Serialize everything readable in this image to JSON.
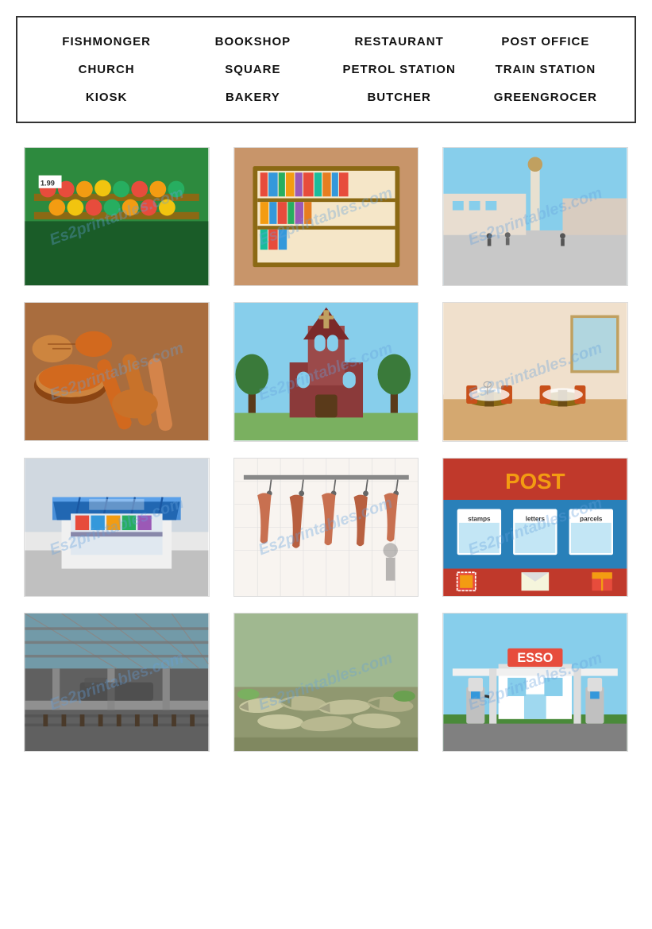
{
  "wordbox": {
    "words": [
      "FISHMONGER",
      "BOOKSHOP",
      "RESTAURANT",
      "POST OFFICE",
      "CHURCH",
      "SQUARE",
      "PETROL STATION",
      "TRAIN STATION",
      "KIOSK",
      "BAKERY",
      "BUTCHER",
      "GREENGROCER"
    ]
  },
  "images": [
    {
      "id": "greengrocer",
      "label": "GREENGROCER",
      "cssClass": "img-greengrocer"
    },
    {
      "id": "bookshop",
      "label": "BOOKSHOP",
      "cssClass": "img-bookshop"
    },
    {
      "id": "square",
      "label": "SQUARE",
      "cssClass": "img-square"
    },
    {
      "id": "bakery",
      "label": "BAKERY",
      "cssClass": "img-bakery"
    },
    {
      "id": "church",
      "label": "CHURCH",
      "cssClass": "img-church"
    },
    {
      "id": "restaurant",
      "label": "RESTAURANT",
      "cssClass": "img-restaurant"
    },
    {
      "id": "kiosk",
      "label": "KIOSK",
      "cssClass": "img-kiosk"
    },
    {
      "id": "butcher",
      "label": "BUTCHER",
      "cssClass": "img-butcher"
    },
    {
      "id": "post-office",
      "label": "POST OFFICE",
      "cssClass": "img-post-office"
    },
    {
      "id": "train-station",
      "label": "TRAIN STATION",
      "cssClass": "img-train-station"
    },
    {
      "id": "fishmonger",
      "label": "FISHMONGER",
      "cssClass": "img-fishmonger"
    },
    {
      "id": "petrol-station",
      "label": "PETROL STATION",
      "cssClass": "img-petrol-station"
    }
  ],
  "watermark": "Es2printables.com"
}
